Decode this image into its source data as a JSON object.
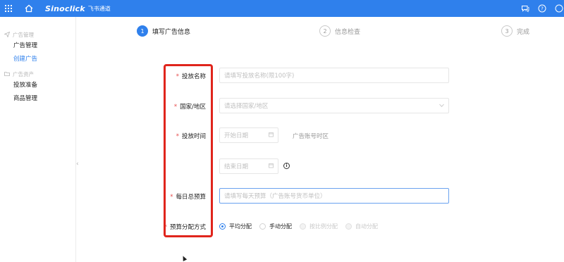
{
  "header": {
    "logo_text": "Sinoclick",
    "logo_sub": "飞书通道",
    "icons": [
      "apps-grid-icon",
      "home-icon",
      "chat-icon",
      "help-icon",
      "user-icon"
    ]
  },
  "sidebar": {
    "groups": [
      {
        "label": "广告管理",
        "items": [
          {
            "label": "广告管理"
          },
          {
            "label": "创建广告",
            "active": true
          }
        ]
      },
      {
        "label": "广告资产",
        "items": [
          {
            "label": "投放准备"
          },
          {
            "label": "商品管理"
          }
        ]
      }
    ],
    "collapse_glyph": "‹"
  },
  "steps": [
    {
      "num": "1",
      "label": "填写广告信息",
      "active": true
    },
    {
      "num": "2",
      "label": "信息检查"
    },
    {
      "num": "3",
      "label": "完成"
    }
  ],
  "form": {
    "required_mark": "*",
    "name": {
      "label": "投放名称",
      "placeholder": "请填写投放名称(限100字)"
    },
    "country": {
      "label": "国家/地区",
      "placeholder": "请选择国家/地区"
    },
    "time": {
      "label": "投放时间",
      "start_placeholder": "开始日期",
      "end_placeholder": "结束日期",
      "timezone_note": "广告账号时区",
      "info": "i"
    },
    "budget": {
      "label": "每日总预算",
      "placeholder": "请填写每天预算（广告账号货币单位）"
    },
    "allocation": {
      "label": "预算分配方式",
      "options": [
        {
          "label": "平均分配",
          "checked": true
        },
        {
          "label": "手动分配"
        },
        {
          "label": "按比例分配",
          "disabled": true
        },
        {
          "label": "自动分配",
          "disabled": true
        }
      ]
    }
  },
  "colors": {
    "primary": "#2f80ec",
    "required": "#e64b4b",
    "highlight": "#e0251c"
  }
}
